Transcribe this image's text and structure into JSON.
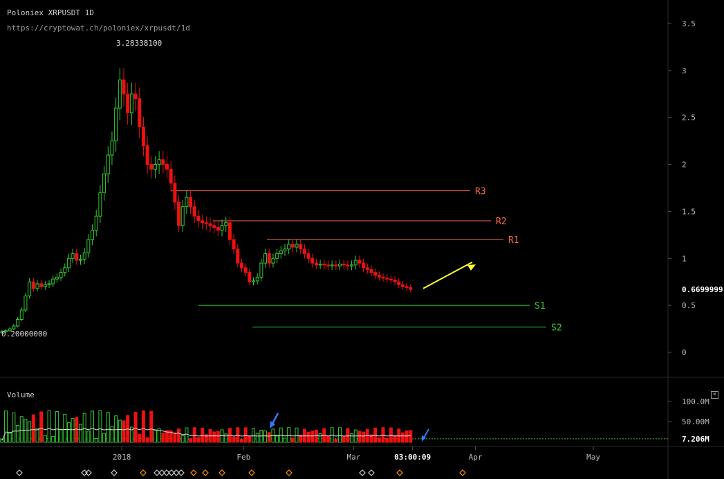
{
  "header": {
    "title": "Poloniex XRPUSDT 1D",
    "url": "https://cryptowat.ch/poloniex/xrpusdt/1d"
  },
  "colors": {
    "up": "#33cc33",
    "down": "#ee1111",
    "resistance_line": "#ff6a4a",
    "support_line": "#33cc33",
    "arrow_yellow": "#ffff33",
    "arrow_blue": "#2a7fff",
    "volume_ma": "#dddddd",
    "marker_diamond": "#ff9900"
  },
  "chart_data": {
    "type": "candlestick",
    "price_axis": {
      "ticks": [
        0,
        0.5,
        1,
        1.5,
        2,
        2.5,
        3,
        3.5
      ],
      "tick_labels": [
        "0",
        "0.5",
        "1",
        "1.5",
        "2",
        "2.5",
        "3",
        "3.5"
      ],
      "ylim": [
        -0.1,
        3.7
      ]
    },
    "time_axis": {
      "labels": [
        "2018",
        "Feb",
        "Mar",
        "03:00:09",
        "Apr",
        "May"
      ],
      "xlim": [
        "2017-12-01",
        "2018-05-20"
      ]
    },
    "annotations": {
      "high_label": "3.28338100",
      "low_label": "0.20000000",
      "last_price_label": "0.6699999"
    },
    "levels": [
      {
        "name": "R3",
        "value": 1.72
      },
      {
        "name": "R2",
        "value": 1.4
      },
      {
        "name": "R1",
        "value": 1.2
      },
      {
        "name": "S1",
        "value": 0.5
      },
      {
        "name": "S2",
        "value": 0.27
      }
    ],
    "closes": [
      0.22,
      0.23,
      0.25,
      0.28,
      0.35,
      0.45,
      0.6,
      0.75,
      0.68,
      0.73,
      0.7,
      0.72,
      0.73,
      0.78,
      0.8,
      0.85,
      0.9,
      1.0,
      1.05,
      0.98,
      0.99,
      1.06,
      1.2,
      1.3,
      1.45,
      1.7,
      1.9,
      2.1,
      2.25,
      2.6,
      2.9,
      2.75,
      2.55,
      2.75,
      2.7,
      2.4,
      2.2,
      2.0,
      1.95,
      2.0,
      2.05,
      2.0,
      1.95,
      1.8,
      1.6,
      1.35,
      1.55,
      1.65,
      1.55,
      1.45,
      1.4,
      1.38,
      1.37,
      1.35,
      1.33,
      1.3,
      1.35,
      1.38,
      1.2,
      1.1,
      0.95,
      0.9,
      0.85,
      0.75,
      0.76,
      0.8,
      0.95,
      1.05,
      0.95,
      1.0,
      1.05,
      1.08,
      1.1,
      1.15,
      1.12,
      1.15,
      1.1,
      1.05,
      1.0,
      0.95,
      0.93,
      0.94,
      0.93,
      0.92,
      0.93,
      0.92,
      0.94,
      0.93,
      0.92,
      0.93,
      0.98,
      0.95,
      0.9,
      0.88,
      0.85,
      0.82,
      0.8,
      0.79,
      0.78,
      0.77,
      0.75,
      0.72,
      0.7,
      0.69,
      0.67
    ],
    "volume_axis": {
      "ticks": [
        100000000,
        50000000
      ],
      "tick_labels": [
        "100.0M",
        "50.00M"
      ],
      "last_label": "7.206M",
      "last_value": 7206000,
      "ylim": [
        0,
        150000000
      ]
    },
    "volume_title": "Volume",
    "timer": "03:00:09"
  }
}
